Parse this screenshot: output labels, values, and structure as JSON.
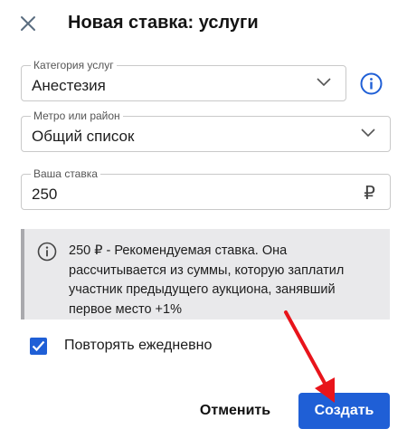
{
  "dialog": {
    "title": "Новая ставка: услуги"
  },
  "category": {
    "label": "Категория услуг",
    "value": "Анестезия"
  },
  "metro": {
    "label": "Метро или район",
    "value": "Общий список"
  },
  "bid": {
    "label": "Ваша ставка",
    "value": "250",
    "currency": "₽"
  },
  "note": {
    "text": "250 ₽ - Рекомендуемая ставка. Она рассчитывается из суммы, которую заплатил участник предыдущего аукциона, занявший первое место +1%"
  },
  "repeat": {
    "label": "Повторять ежедневно",
    "checked": true
  },
  "actions": {
    "cancel": "Отменить",
    "create": "Создать"
  },
  "colors": {
    "primary": "#1f5fd6",
    "annotation_arrow": "#e8141b",
    "note_bg": "#e9e9eb"
  },
  "icons": [
    "close-icon",
    "chevron-down-icon",
    "info-icon",
    "checkmark-icon",
    "arrow-annotation"
  ]
}
